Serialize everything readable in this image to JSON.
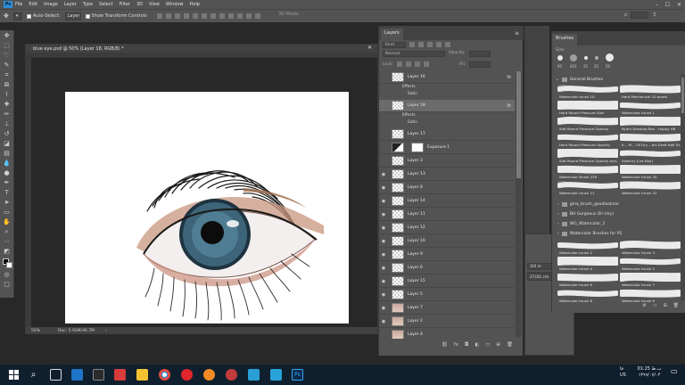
{
  "app": {
    "menu": [
      "File",
      "Edit",
      "Image",
      "Layer",
      "Type",
      "Select",
      "Filter",
      "3D",
      "View",
      "Window",
      "Help"
    ],
    "window_controls": [
      "–",
      "☐",
      "✕"
    ]
  },
  "options_bar": {
    "auto_select_label": "Auto-Select:",
    "auto_select_value": "Layer",
    "show_transform_label": "Show Transform Controls",
    "mode_3d_label": "3D Mode:"
  },
  "document": {
    "tab_title": "blue eye.psd @ 50% (Layer 18, RGB/8) *",
    "zoom": "50%",
    "doc_info": "Doc: 5.93M/46.7M"
  },
  "layers_panel": {
    "tab_label": "Layers",
    "filter_kind": "Kind",
    "blend_mode": "Normal",
    "opacity_label": "Opacity:",
    "lock_label": "Lock:",
    "fill_label": "Fill:",
    "rows": [
      {
        "name": "Layer 16",
        "fx": true,
        "visible": false,
        "thumb": "trans",
        "effects": [
          "Effects",
          "Satin"
        ]
      },
      {
        "name": "Layer 18",
        "fx": true,
        "visible": false,
        "thumb": "trans",
        "selected": true,
        "effects": [
          "Effects",
          "Satin"
        ]
      },
      {
        "name": "Layer 17",
        "fx": false,
        "visible": false,
        "thumb": "trans"
      },
      {
        "name": "Exposure 1",
        "fx": false,
        "visible": false,
        "thumb": "white",
        "adjust": true
      },
      {
        "name": "Layer 3",
        "fx": false,
        "visible": false,
        "thumb": "trans"
      },
      {
        "name": "Layer 13",
        "fx": false,
        "visible": true,
        "thumb": "trans"
      },
      {
        "name": "Layer 8",
        "fx": false,
        "visible": true,
        "thumb": "trans"
      },
      {
        "name": "Layer 14",
        "fx": false,
        "visible": true,
        "thumb": "trans"
      },
      {
        "name": "Layer 11",
        "fx": false,
        "visible": true,
        "thumb": "trans"
      },
      {
        "name": "Layer 12",
        "fx": false,
        "visible": true,
        "thumb": "trans"
      },
      {
        "name": "Layer 10",
        "fx": false,
        "visible": true,
        "thumb": "trans"
      },
      {
        "name": "Layer 9",
        "fx": false,
        "visible": true,
        "thumb": "trans"
      },
      {
        "name": "Layer 6",
        "fx": false,
        "visible": true,
        "thumb": "trans"
      },
      {
        "name": "Layer 15",
        "fx": false,
        "visible": true,
        "thumb": "trans"
      },
      {
        "name": "Layer 5",
        "fx": false,
        "visible": true,
        "thumb": "trans"
      },
      {
        "name": "Layer 7",
        "fx": false,
        "visible": true,
        "thumb": "photo"
      },
      {
        "name": "Layer 2",
        "fx": false,
        "visible": true,
        "thumb": "photo"
      },
      {
        "name": "Layer 4",
        "fx": false,
        "visible": false,
        "thumb": "photo"
      },
      {
        "name": "Layer 1",
        "fx": false,
        "visible": true,
        "thumb": "white"
      }
    ],
    "bottom_icons": [
      "link-icon",
      "fx-icon",
      "mask-icon",
      "adjustment-icon",
      "group-icon",
      "new-layer-icon",
      "trash-icon"
    ]
  },
  "info_panel": {
    "values": [
      "3/4 in",
      "",
      "27/41 cm"
    ]
  },
  "brushes_panel": {
    "tab_label": "Brushes",
    "size_label": "Size:",
    "presets": [
      "93",
      "401",
      "25",
      "25",
      "50"
    ],
    "group_label": "General Brushes",
    "brushes": [
      {
        "num": "1005",
        "label": "Watercolor brush 10"
      },
      {
        "num": "10",
        "label": "Hard Mechanical 10 pixels"
      },
      {
        "num": "",
        "label": "Hard Round Pressure Size"
      },
      {
        "num": "",
        "label": "Watercolor brush 1"
      },
      {
        "num": "",
        "label": "Soft Round Pressure Opacity"
      },
      {
        "num": "",
        "label": "Kyle's Drawing Box - Happy HB"
      },
      {
        "num": "",
        "label": "Hard Round Pressure Opacity"
      },
      {
        "num": "",
        "label": "K... M... Oil Dry – Art Draft Half Dr..."
      },
      {
        "num": "",
        "label": "Soft Round Pressure Opacity and..."
      },
      {
        "num": "",
        "label": "Sketchy [Les Ron]"
      },
      {
        "num": "",
        "label": "Watercolor Brush 239"
      },
      {
        "num": "",
        "label": "Watercolor brush 20"
      },
      {
        "num": "1275",
        "label": "Watercolor brush 21"
      },
      {
        "num": "1727",
        "label": "Watercolor brush 22"
      }
    ],
    "folders": [
      "gma_brush_goodlookme",
      "BH Gorgeous Oil (dry)",
      "WG_Watercolor_1",
      "Watercolor Brushes for PS"
    ],
    "brushes2": [
      {
        "num": "",
        "label": "Watercolor brush 2"
      },
      {
        "num": "",
        "label": "Watercolor brush 3"
      },
      {
        "num": "",
        "label": "Watercolor brush 4"
      },
      {
        "num": "",
        "label": "Watercolor brush 5"
      },
      {
        "num": "",
        "label": "Watercolor brush 6"
      },
      {
        "num": "",
        "label": "Watercolor brush 7"
      },
      {
        "num": "",
        "label": "Watercolor brush 8"
      },
      {
        "num": "",
        "label": "Watercolor brush 9"
      }
    ]
  },
  "taskbar": {
    "time": "01:25 ب.ظ",
    "date": "۱۳۹۹/۰۷/۰۴",
    "lang": "فا",
    "lang2": "US"
  }
}
